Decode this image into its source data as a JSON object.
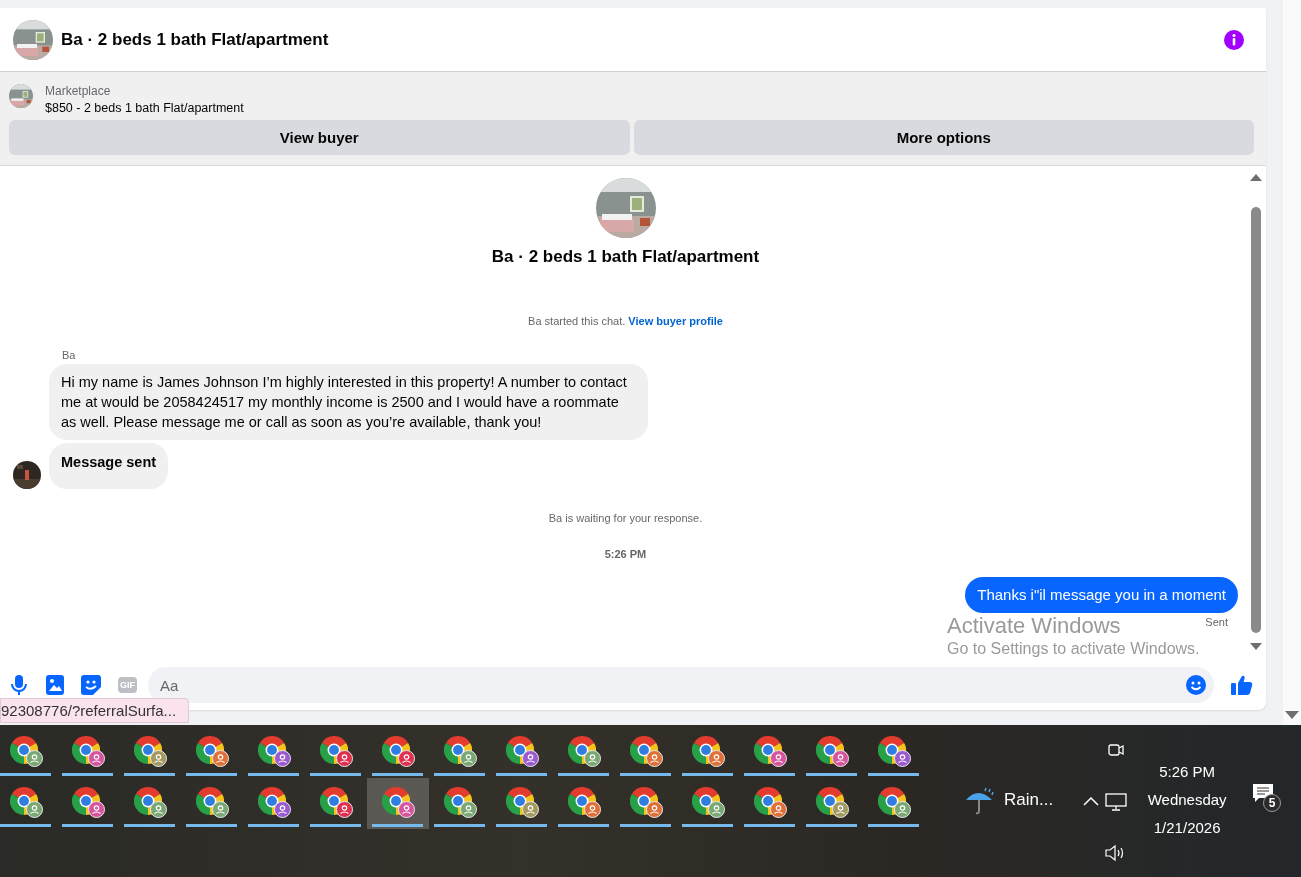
{
  "chat_header": {
    "title": "Ba · 2 beds 1 bath Flat/apartment"
  },
  "listing": {
    "source": "Marketplace",
    "summary": "$850 - 2 beds 1 bath Flat/apartment",
    "buttons": [
      "View buyer",
      "More options"
    ]
  },
  "conversation": {
    "title": "Ba · 2 beds 1 bath Flat/apartment",
    "started_note": "Ba started this chat.",
    "profile_link": "View buyer profile",
    "timeline": [
      {
        "kind": "sender",
        "text": "Ba"
      },
      {
        "kind": "incoming",
        "text": "Hi my name is James Johnson I’m highly interested in this property! A number to contact me at would be 2058424517 my monthly income is 2500 and I would have a roommate as well. Please message me or call as soon as you’re available, thank you!",
        "bold": false,
        "avatar": false
      },
      {
        "kind": "incoming",
        "text": "Message sent",
        "bold": true,
        "avatar": true
      },
      {
        "kind": "note",
        "text": "Ba is waiting for your response."
      },
      {
        "kind": "timestamp",
        "text": "5:26 PM"
      },
      {
        "kind": "outgoing",
        "text": "Thanks i\"il message you in a moment"
      },
      {
        "kind": "receipt",
        "text": "Sent"
      }
    ]
  },
  "composer": {
    "gif_label": "GIF",
    "placeholder": "Aa"
  },
  "link_preview": "92308776/?referralSurfa...",
  "os_notice": {
    "title": "Activate Windows",
    "subtitle": "Go to Settings to activate Windows."
  },
  "taskbar": {
    "rows": [
      {
        "apps": [
          {
            "color": "#7aa874",
            "selected": false
          },
          {
            "color": "#d6559e",
            "selected": false
          },
          {
            "color": "#a39a62",
            "selected": false
          },
          {
            "color": "#e0703a",
            "selected": false
          },
          {
            "color": "#9a5bd0",
            "selected": false
          },
          {
            "color": "#e0304f",
            "selected": false
          },
          {
            "color": "#e0304f",
            "selected": false
          },
          {
            "color": "#7aa874",
            "selected": false
          },
          {
            "color": "#9a5bd0",
            "selected": false
          },
          {
            "color": "#7aa874",
            "selected": false
          },
          {
            "color": "#e0703a",
            "selected": false
          },
          {
            "color": "#e0703a",
            "selected": false
          },
          {
            "color": "#d6559e",
            "selected": false
          },
          {
            "color": "#d6559e",
            "selected": false
          },
          {
            "color": "#9a5bd0",
            "selected": false
          }
        ]
      },
      {
        "apps": [
          {
            "color": "#7aa874",
            "selected": false
          },
          {
            "color": "#d6559e",
            "selected": false
          },
          {
            "color": "#7aa874",
            "selected": false
          },
          {
            "color": "#7aa874",
            "selected": false
          },
          {
            "color": "#9a5bd0",
            "selected": false
          },
          {
            "color": "#e0304f",
            "selected": false
          },
          {
            "color": "#d6559e",
            "selected": true
          },
          {
            "color": "#7aa874",
            "selected": false
          },
          {
            "color": "#a39a62",
            "selected": false
          },
          {
            "color": "#e0703a",
            "selected": false
          },
          {
            "color": "#e0703a",
            "selected": false
          },
          {
            "color": "#7aa874",
            "selected": false
          },
          {
            "color": "#e0703a",
            "selected": false
          },
          {
            "color": "#a39a62",
            "selected": false
          },
          {
            "color": "#7aa874",
            "selected": false
          }
        ]
      }
    ],
    "weather": "Rain...",
    "time": "5:26 PM",
    "day": "Wednesday",
    "date": "1/21/2026",
    "notification_count": "5"
  }
}
